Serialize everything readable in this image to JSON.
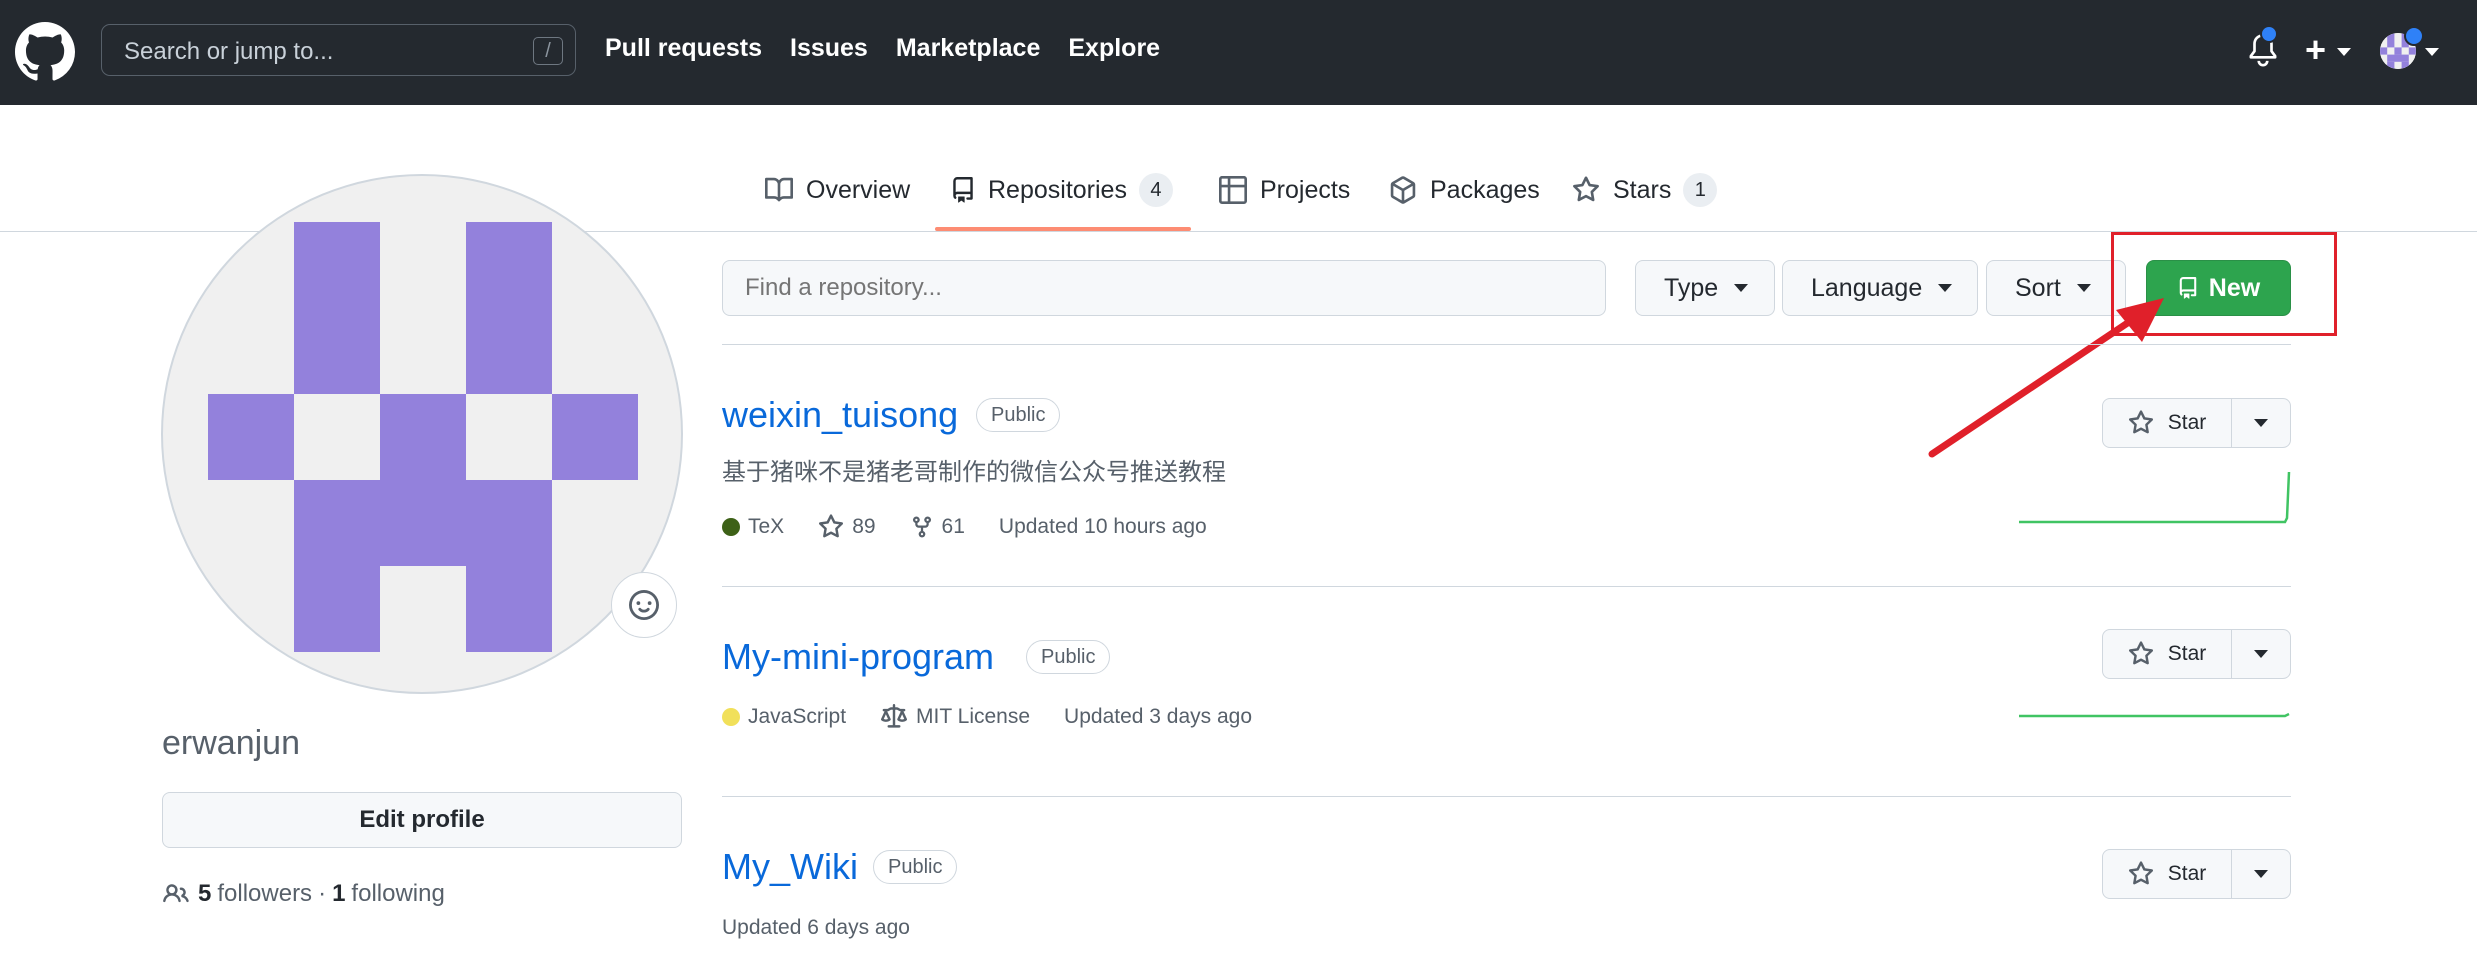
{
  "header": {
    "search_placeholder": "Search or jump to...",
    "search_shortcut": "/",
    "nav": [
      "Pull requests",
      "Issues",
      "Marketplace",
      "Explore"
    ],
    "plus_label": "+"
  },
  "tabs": [
    {
      "label": "Overview",
      "icon": "book-icon"
    },
    {
      "label": "Repositories",
      "icon": "repo-icon",
      "count": "4"
    },
    {
      "label": "Projects",
      "icon": "table-icon"
    },
    {
      "label": "Packages",
      "icon": "package-icon"
    },
    {
      "label": "Stars",
      "icon": "star-icon",
      "count": "1"
    }
  ],
  "profile": {
    "username": "erwanjun",
    "edit_label": "Edit profile",
    "followers_count": "5",
    "followers_label": "followers",
    "separator": "·",
    "following_count": "1",
    "following_label": "following"
  },
  "filters": {
    "find_placeholder": "Find a repository...",
    "type_label": "Type",
    "language_label": "Language",
    "sort_label": "Sort",
    "new_label": "New"
  },
  "repos": [
    {
      "name": "weixin_tuisong",
      "visibility": "Public",
      "description": "基于猪咪不是猪老哥制作的微信公众号推送教程",
      "language": "TeX",
      "language_color": "#3D6117",
      "stars": "89",
      "forks": "61",
      "updated": "Updated 10 hours ago",
      "star_label": "Star"
    },
    {
      "name": "My-mini-program",
      "visibility": "Public",
      "language": "JavaScript",
      "language_color": "#f1e05a",
      "license": "MIT License",
      "updated": "Updated 3 days ago",
      "star_label": "Star"
    },
    {
      "name": "My_Wiki",
      "visibility": "Public",
      "updated": "Updated 6 days ago",
      "star_label": "Star"
    }
  ],
  "colors": {
    "header_bg": "#24292f",
    "accent_green": "#2da44e",
    "link_blue": "#0969da",
    "avatar_purple": "#9381dc",
    "annotation_red": "#e0202a"
  }
}
